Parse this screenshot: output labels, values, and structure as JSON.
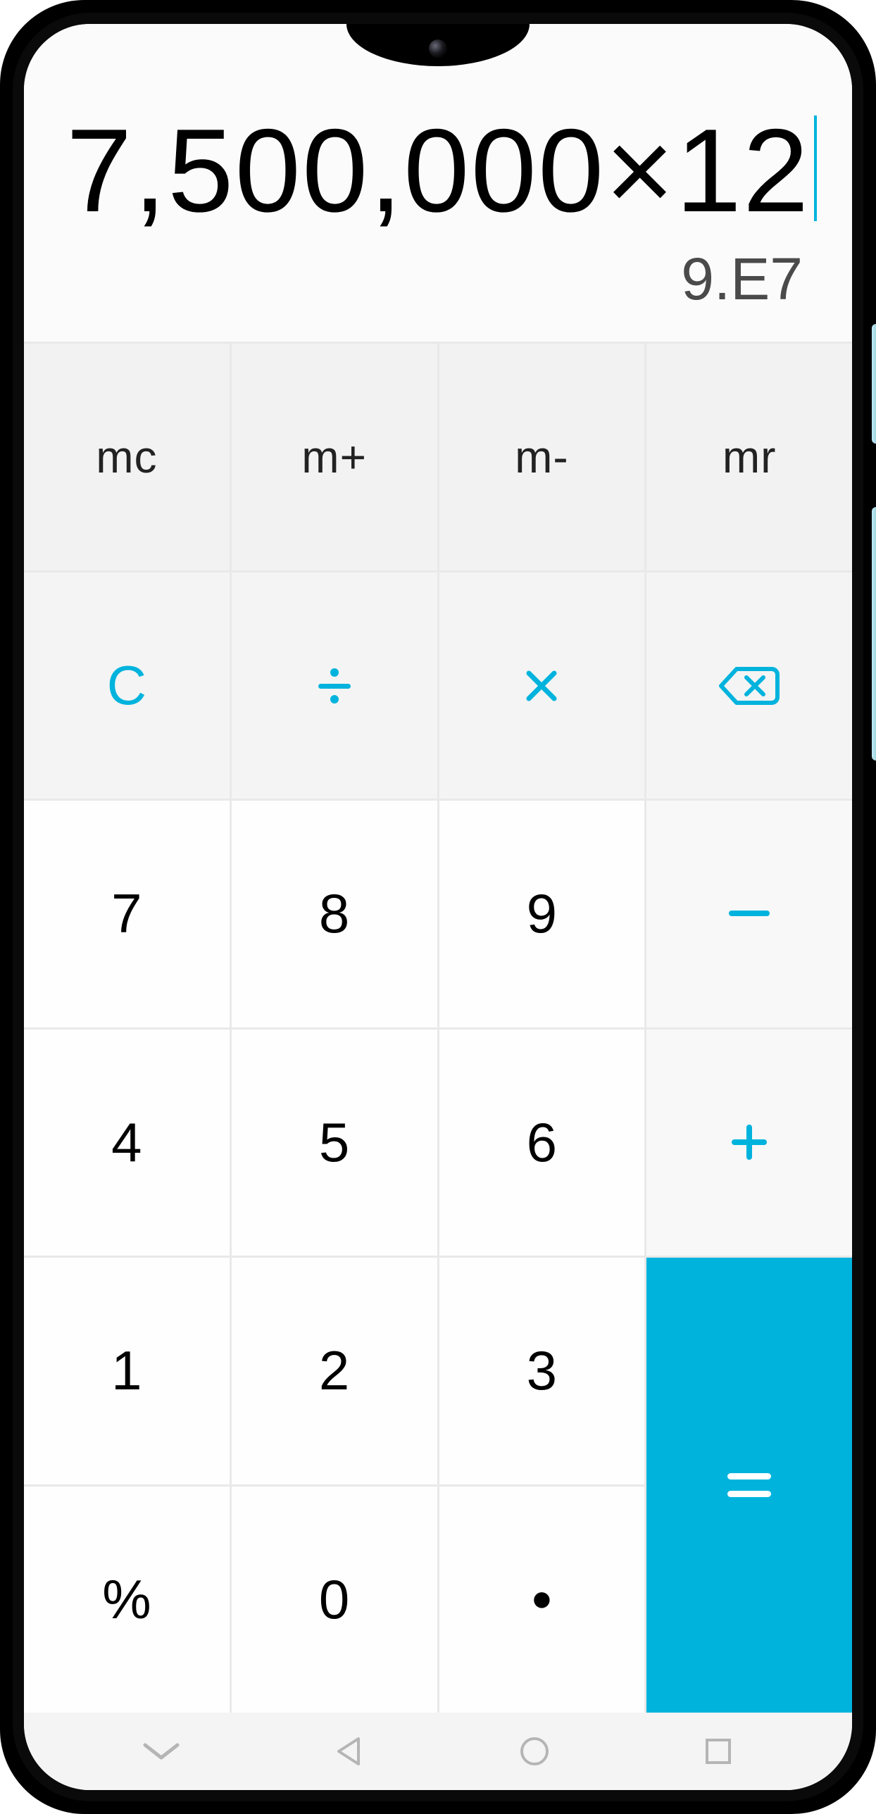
{
  "display": {
    "expression": "7,500,000×12",
    "result": "9.E7"
  },
  "colors": {
    "accent": "#00b3dd",
    "key_bg": "#fefefe",
    "fn_bg": "#f4f4f4",
    "mem_bg": "#f2f2f2",
    "screen_bg": "#fbfbfb"
  },
  "keys": {
    "mc": "mc",
    "m_plus": "m+",
    "m_minus": "m-",
    "mr": "mr",
    "clear": "C",
    "divide": "÷",
    "multiply": "×",
    "backspace": "⌫",
    "d7": "7",
    "d8": "8",
    "d9": "9",
    "minus": "−",
    "d4": "4",
    "d5": "5",
    "d6": "6",
    "plus": "+",
    "d1": "1",
    "d2": "2",
    "d3": "3",
    "equals": "=",
    "percent": "%",
    "d0": "0",
    "decimal": "."
  },
  "nav": {
    "collapse": "chevron-down",
    "back": "triangle-left",
    "home": "circle",
    "recent": "square"
  }
}
